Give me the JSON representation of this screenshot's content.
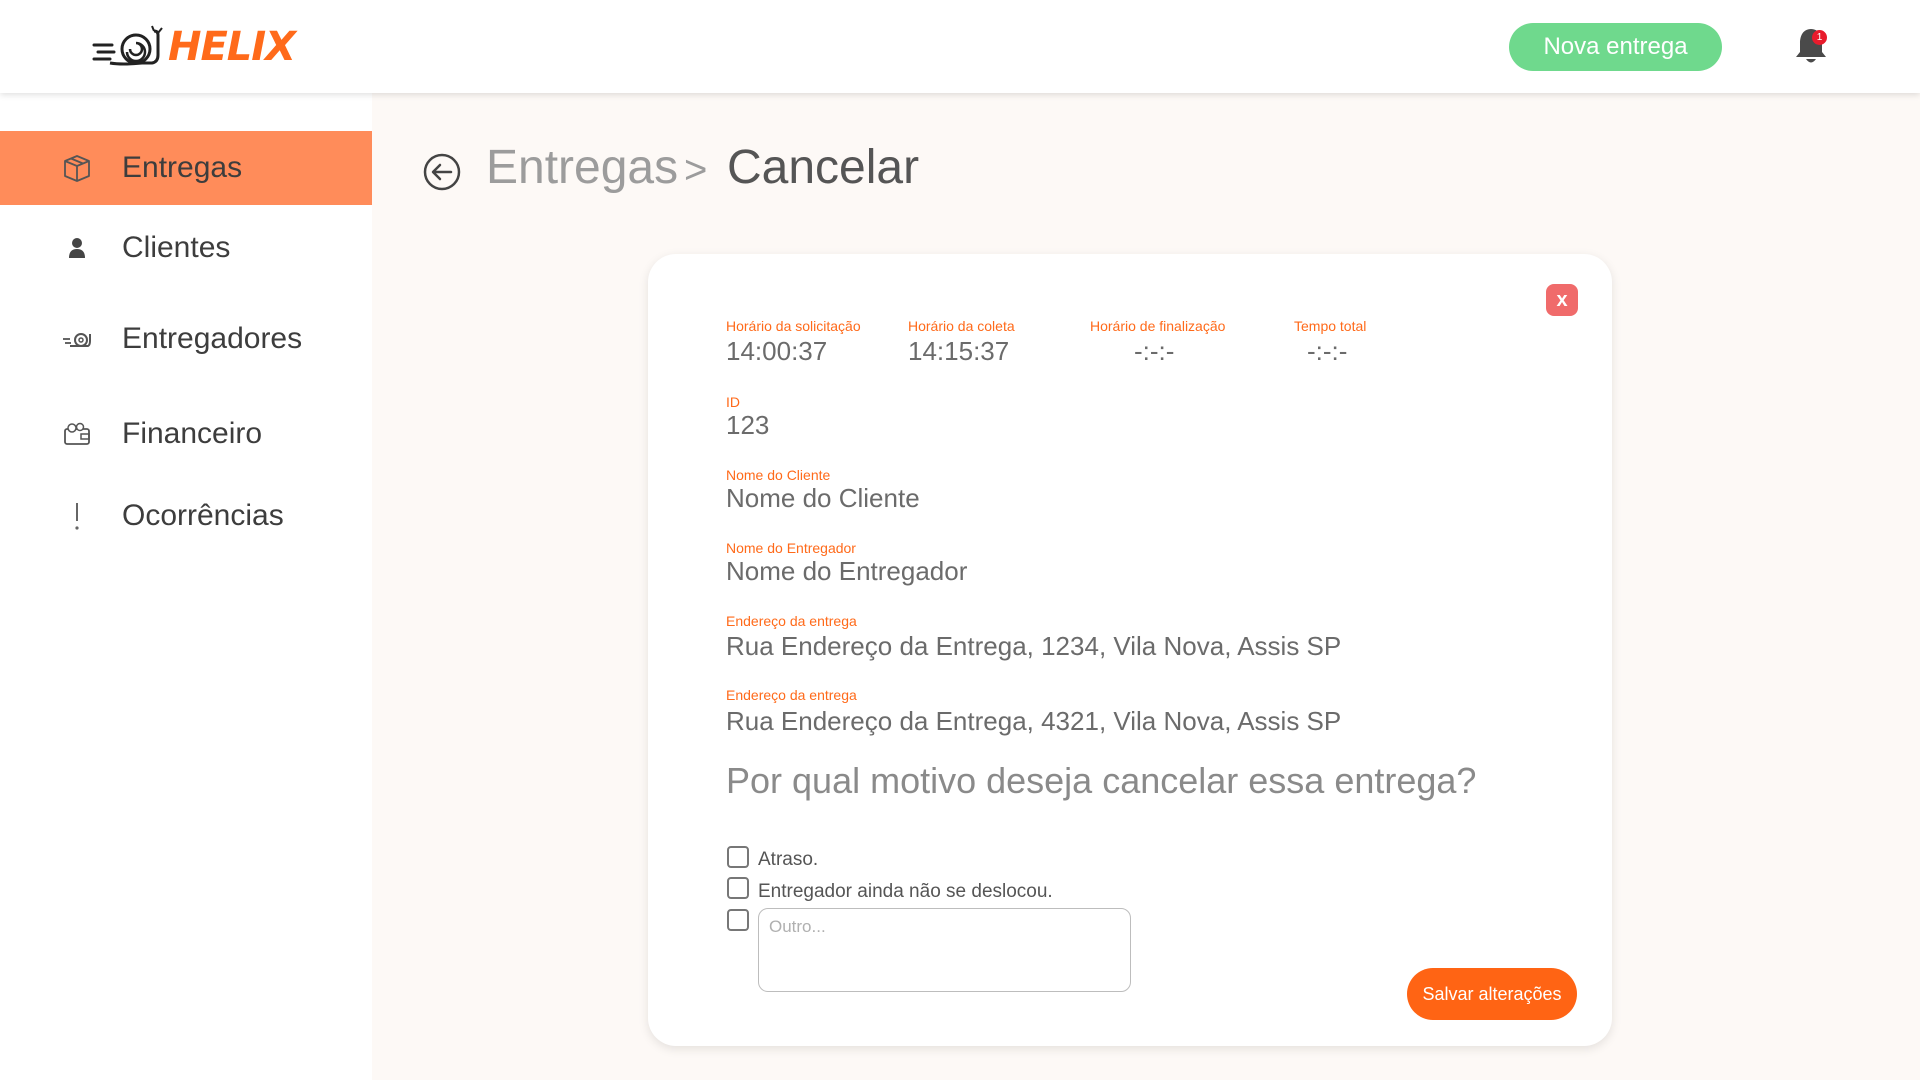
{
  "header": {
    "logo_text": "HELIX",
    "new_delivery_button": "Nova entrega",
    "notification_count": "1",
    "brand_color": "#ff6a1a",
    "accent_green": "#6fd98d"
  },
  "sidebar": {
    "active_color": "#ff8c5a",
    "items": [
      {
        "label": "Entregas",
        "icon": "package-icon",
        "active": true
      },
      {
        "label": "Clientes",
        "icon": "person-icon",
        "active": false
      },
      {
        "label": "Entregadores",
        "icon": "snail-courier-icon",
        "active": false
      },
      {
        "label": "Financeiro",
        "icon": "wallet-icon",
        "active": false
      },
      {
        "label": "Ocorrências",
        "icon": "exclamation-icon",
        "active": false
      }
    ]
  },
  "breadcrumb": {
    "parent": "Entregas",
    "separator": ">",
    "current": "Cancelar"
  },
  "details": {
    "request_time_label": "Horário da solicitação",
    "request_time": "14:00:37",
    "pickup_time_label": "Horário da coleta",
    "pickup_time": "14:15:37",
    "finish_time_label": "Horário de finalização",
    "finish_time": "-:-:-",
    "total_time_label": "Tempo total",
    "total_time": "-:-:-",
    "id_label": "ID",
    "id": "123",
    "client_label": "Nome do Cliente",
    "client": "Nome do Cliente",
    "courier_label": "Nome do Entregador",
    "courier": "Nome do Entregador",
    "address1_label": "Endereço da entrega",
    "address1": "Rua Endereço da Entrega, 1234, Vila Nova, Assis SP",
    "address2_label": "Endereço da entrega",
    "address2": "Rua Endereço da Entrega, 4321, Vila Nova, Assis SP"
  },
  "cancel": {
    "question": "Por qual motivo deseja cancelar essa entrega?",
    "options": [
      {
        "label": "Atraso.",
        "checked": false
      },
      {
        "label": "Entregador ainda não se deslocou.",
        "checked": false
      }
    ],
    "other_checked": false,
    "other_placeholder": "Outro...",
    "other_value": "",
    "close_symbol": "x",
    "save_button": "Salvar alterações"
  }
}
